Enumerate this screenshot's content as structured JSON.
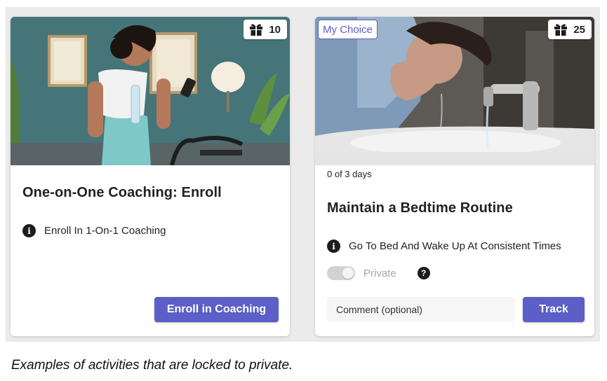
{
  "cards": [
    {
      "title": "One-on-One Coaching: Enroll",
      "reward_count": "10",
      "reward_icon": "gift-icon",
      "description_icon": "info-icon",
      "description": "Enroll In 1-On-1 Coaching",
      "action_label": "Enroll in Coaching"
    },
    {
      "badge": "My Choice",
      "reward_count": "25",
      "reward_icon": "gift-icon",
      "progress": "0 of 3 days",
      "title": "Maintain a Bedtime Routine",
      "description_icon": "info-icon",
      "description": "Go To Bed And Wake Up At Consistent Times",
      "privacy": {
        "label": "Private",
        "toggle_on": true,
        "disabled": true,
        "help_icon": "question-icon",
        "help_glyph": "?"
      },
      "comment_placeholder": "Comment (optional)",
      "action_label": "Track"
    }
  ],
  "caption": "Examples of activities that are locked to private.",
  "colors": {
    "accent": "#5b5fc7",
    "panel_background": "#ebebeb",
    "toggle_disabled": "#d2d2d2",
    "muted_text": "#a5a5a5"
  }
}
